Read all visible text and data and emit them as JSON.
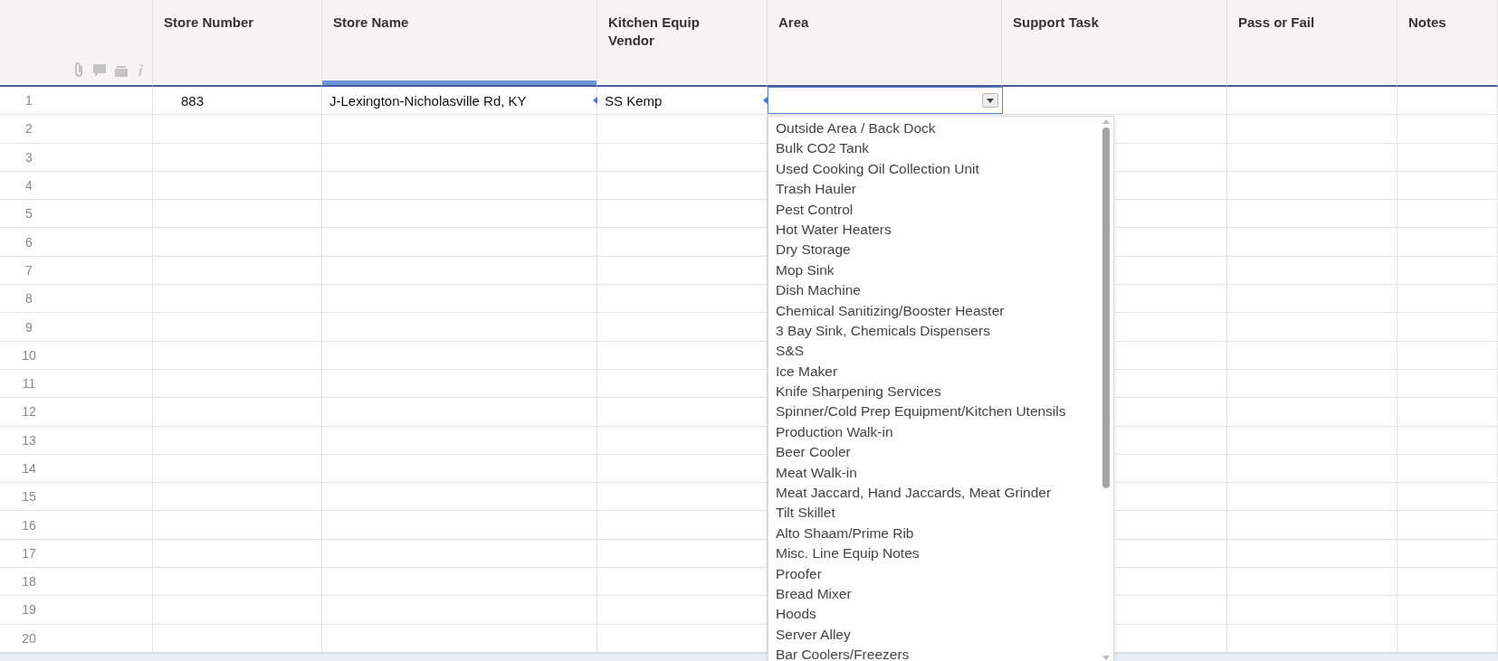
{
  "columns": [
    {
      "label": "Store Number",
      "highlighted": false
    },
    {
      "label": "Store Name",
      "highlighted": true
    },
    {
      "label": "Kitchen Equip Vendor",
      "highlighted": false
    },
    {
      "label": "Area",
      "highlighted": false
    },
    {
      "label": "Support Task",
      "highlighted": false
    },
    {
      "label": "Pass or Fail",
      "highlighted": false
    },
    {
      "label": "Notes",
      "highlighted": false
    }
  ],
  "rows": [
    {
      "number": "1",
      "cells": [
        {
          "kind": "text",
          "text": "883"
        },
        {
          "kind": "text",
          "text": "J-Lexington-Nicholasville Rd, KY",
          "flag": true
        },
        {
          "kind": "text",
          "text": "SS Kemp",
          "flag": true
        },
        {
          "kind": "dropdown",
          "open": true,
          "options": [
            {
              "label": "Outside Area / Back Dock",
              "selected": false
            },
            {
              "label": "Bulk CO2 Tank",
              "selected": false
            },
            {
              "label": "Used Cooking Oil Collection Unit",
              "selected": false
            },
            {
              "label": "Trash Hauler",
              "selected": false
            },
            {
              "label": "Pest Control",
              "selected": false
            },
            {
              "label": "Hot Water Heaters",
              "selected": false
            },
            {
              "label": "Dry Storage",
              "selected": false
            },
            {
              "label": "Mop Sink",
              "selected": false
            },
            {
              "label": "Dish Machine",
              "selected": false
            },
            {
              "label": "Chemical Sanitizing/Booster Heaster",
              "selected": false
            },
            {
              "label": "3 Bay Sink, Chemicals Dispensers",
              "selected": false
            },
            {
              "label": "S&S",
              "selected": false
            },
            {
              "label": "Ice Maker",
              "selected": false
            },
            {
              "label": "Knife Sharpening Services",
              "selected": false
            },
            {
              "label": "Spinner/Cold Prep Equipment/Kitchen Utensils",
              "selected": false
            },
            {
              "label": "Production Walk-in",
              "selected": false
            },
            {
              "label": "Beer Cooler",
              "selected": false
            },
            {
              "label": "Meat Walk-in",
              "selected": false
            },
            {
              "label": "Meat Jaccard, Hand Jaccards, Meat Grinder",
              "selected": false
            },
            {
              "label": "Tilt Skillet",
              "selected": false
            },
            {
              "label": "Alto Shaam/Prime Rib",
              "selected": false
            },
            {
              "label": "Misc. Line Equip Notes",
              "selected": false
            },
            {
              "label": "Proofer",
              "selected": false
            },
            {
              "label": "Bread Mixer",
              "selected": false
            },
            {
              "label": "Hoods",
              "selected": false
            },
            {
              "label": "Server Alley",
              "selected": false
            },
            {
              "label": "Bar Coolers/Freezers",
              "selected": false
            }
          ]
        },
        {
          "kind": "blank"
        },
        {
          "kind": "blank"
        },
        {
          "kind": "blank"
        }
      ]
    },
    {
      "number": "2"
    },
    {
      "number": "3"
    },
    {
      "number": "4"
    },
    {
      "number": "5"
    },
    {
      "number": "6"
    },
    {
      "number": "7"
    },
    {
      "number": "8"
    },
    {
      "number": "9"
    },
    {
      "number": "10"
    },
    {
      "number": "11"
    },
    {
      "number": "12"
    },
    {
      "number": "13"
    },
    {
      "number": "14"
    },
    {
      "number": "15"
    },
    {
      "number": "16"
    },
    {
      "number": "17"
    },
    {
      "number": "18"
    },
    {
      "number": "19"
    },
    {
      "number": "20"
    }
  ]
}
